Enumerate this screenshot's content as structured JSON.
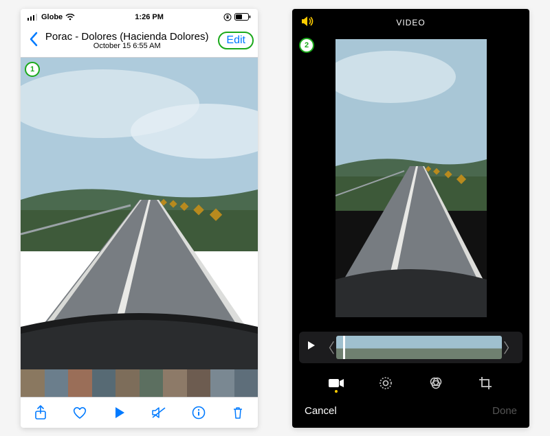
{
  "left": {
    "status": {
      "carrier": "Globe",
      "time": "1:26 PM"
    },
    "nav": {
      "title": "Porac - Dolores (Hacienda Dolores)",
      "subtitle": "October 15  6:55 AM",
      "edit_label": "Edit"
    },
    "step_badge": "1",
    "toolbar_icons": [
      "share-icon",
      "favorite-icon",
      "play-icon",
      "mute-icon",
      "info-icon",
      "trash-icon"
    ]
  },
  "right": {
    "header": "VIDEO",
    "step_badge": "2",
    "bottom": {
      "cancel": "Cancel",
      "done": "Done"
    },
    "edit_tab_icons": [
      "video-icon",
      "adjust-icon",
      "filters-icon",
      "crop-icon"
    ]
  }
}
